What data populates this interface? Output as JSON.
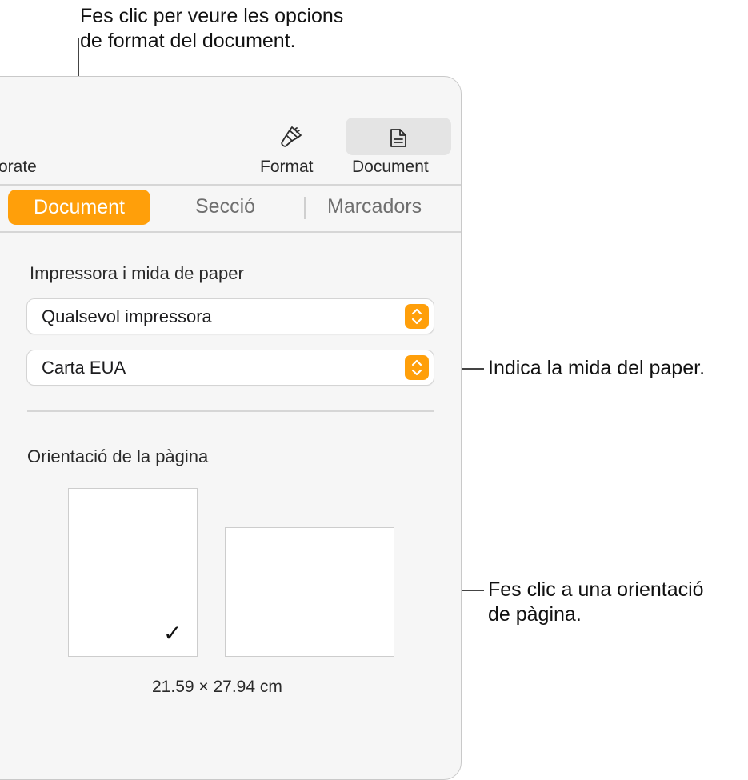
{
  "callouts": {
    "top_line1": "Fes clic per veure les opcions",
    "top_line2": "de format del document.",
    "paper_size": "Indica la mida del paper.",
    "orientation_line1": "Fes clic a una orientació",
    "orientation_line2": "de pàgina."
  },
  "toolbar": {
    "partial_left_label": "orate",
    "format_label": "Format",
    "document_label": "Document",
    "format_icon": "paintbrush-icon",
    "document_icon": "document-icon"
  },
  "tabs": [
    {
      "label": "Document",
      "active": true
    },
    {
      "label": "Secció",
      "active": false
    },
    {
      "label": "Marcadors",
      "active": false
    }
  ],
  "printer_section": {
    "title": "Impressora i mida de paper",
    "printer_value": "Qualsevol impressora",
    "paper_value": "Carta EUA"
  },
  "orientation_section": {
    "title": "Orientació de la pàgina",
    "selected": "portrait",
    "check_glyph": "✓",
    "dimensions": "21.59 × 27.94 cm"
  },
  "colors": {
    "accent": "#ff9f0a",
    "panel_bg": "#f6f6f6",
    "text": "#1d1d1f"
  }
}
